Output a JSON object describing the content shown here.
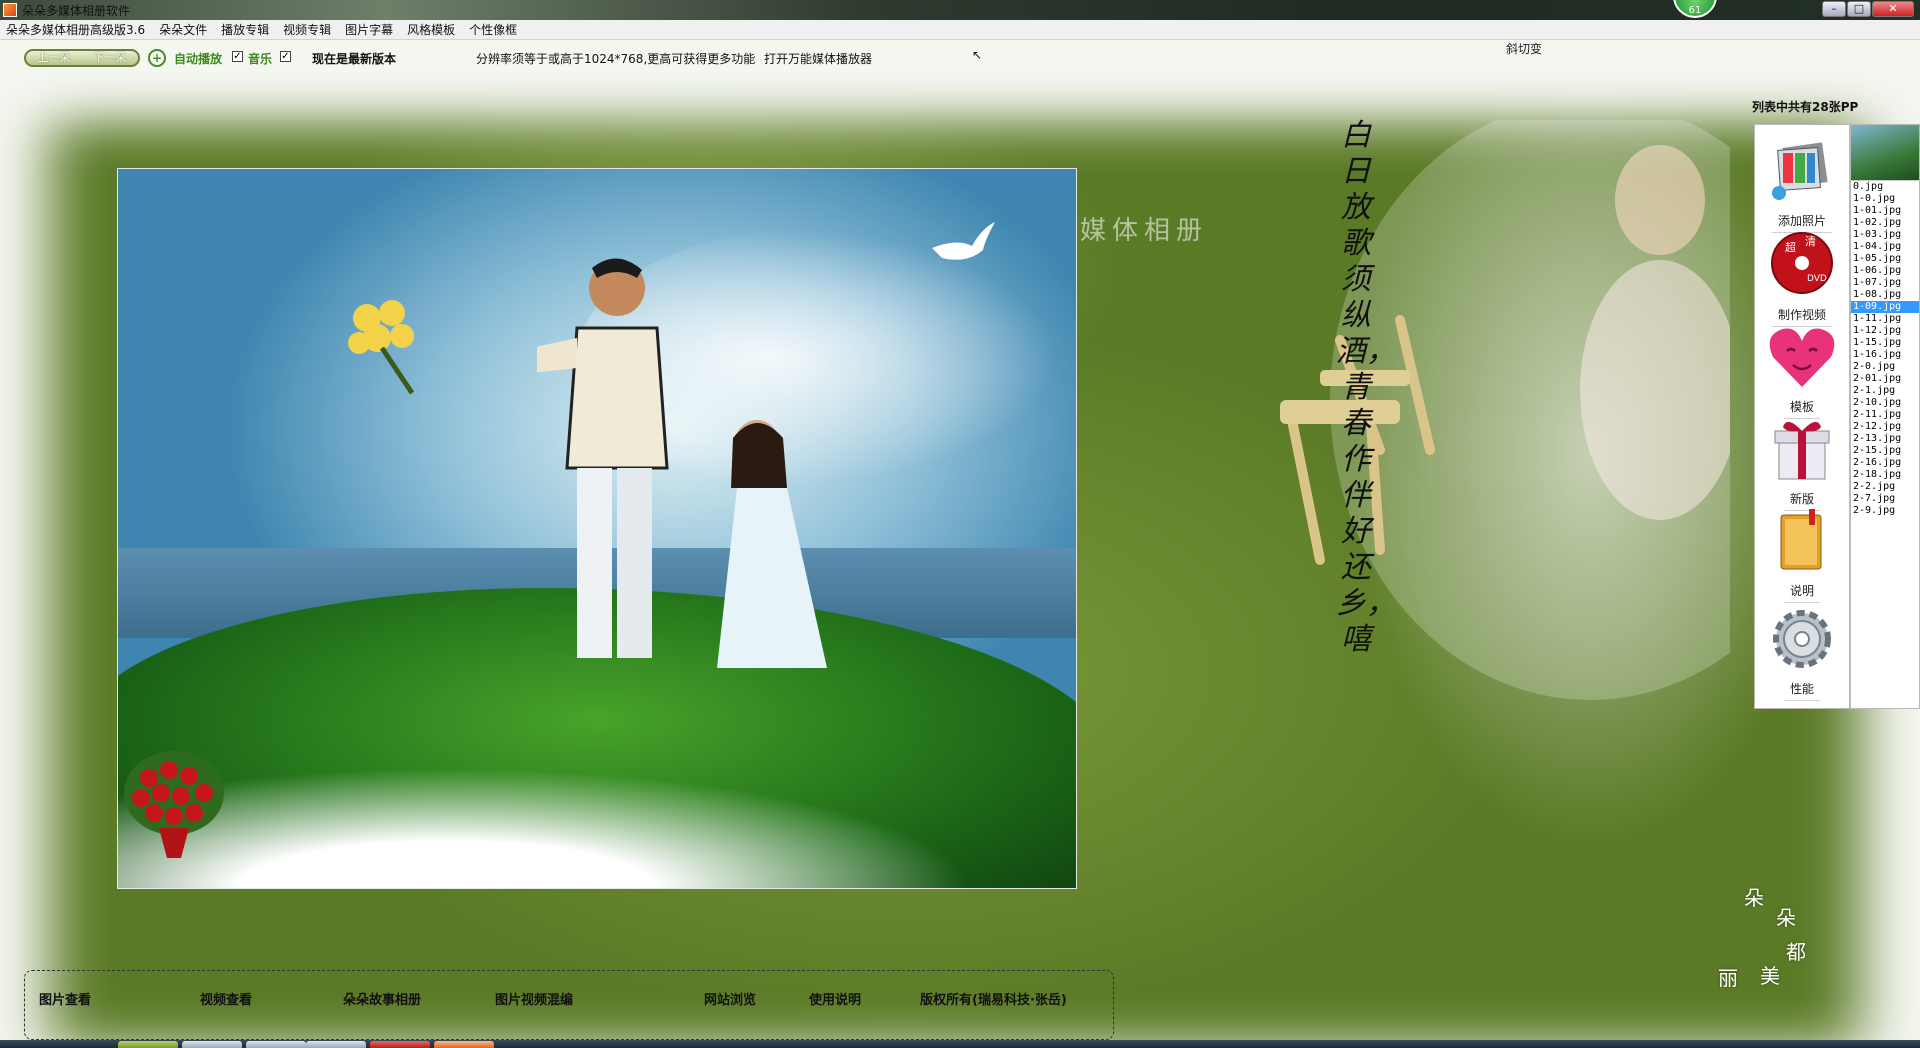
{
  "window": {
    "title": "朵朵多媒体相册软件",
    "badge": "61",
    "buttons": {
      "minimize": "–",
      "maximize": "□",
      "close": "✕"
    }
  },
  "menu": [
    "朵朵多媒体相册高级版3.6",
    "朵朵文件",
    "播放专辑",
    "视频专辑",
    "图片字幕",
    "风格模板",
    "个性像框"
  ],
  "controls": {
    "prev": "上一朵",
    "next": "下一朵",
    "autoplay_label": "自动播放",
    "autoplay_checked": "✓",
    "music_label": "音乐",
    "music_checked": "✓",
    "version_status": "现在是最新版本",
    "resolution_hint": "分辨率须等于或高于1024*768,更高可获得更多功能",
    "open_player": "打开万能媒体播放器",
    "transition": "斜切变"
  },
  "stage": {
    "watermark": "媒体相册",
    "poem": "白日放歌须纵酒，青春作伴好还乡，嘻",
    "signature": [
      "朵",
      "朵",
      "都",
      "丽",
      "美"
    ]
  },
  "side_panel": {
    "list_count": "列表中共有28张PP",
    "buttons": [
      {
        "label": "添加照片",
        "icon": "add-photo-icon"
      },
      {
        "label": "制作视频",
        "icon": "dvd-icon"
      },
      {
        "label": "模板",
        "icon": "heart-icon"
      },
      {
        "label": "新版",
        "icon": "gift-icon"
      },
      {
        "label": "说明",
        "icon": "book-icon"
      },
      {
        "label": "性能",
        "icon": "gear-icon"
      }
    ],
    "files": [
      "0.jpg",
      "1-0.jpg",
      "1-01.jpg",
      "1-02.jpg",
      "1-03.jpg",
      "1-04.jpg",
      "1-05.jpg",
      "1-06.jpg",
      "1-07.jpg",
      "1-08.jpg",
      "1-09.jpg",
      "1-11.jpg",
      "1-12.jpg",
      "1-15.jpg",
      "1-16.jpg",
      "2-0.jpg",
      "2-01.jpg",
      "2-1.jpg",
      "2-10.jpg",
      "2-11.jpg",
      "2-12.jpg",
      "2-13.jpg",
      "2-15.jpg",
      "2-16.jpg",
      "2-18.jpg",
      "2-2.jpg",
      "2-7.jpg",
      "2-9.jpg"
    ],
    "selected_file": "1-09.jpg"
  },
  "bottom_nav": [
    "图片查看",
    "视频查看",
    "朵朵故事相册",
    "图片视频混编",
    "网站浏览",
    "使用说明",
    "版权所有(瑞易科技·张岳)"
  ],
  "colors": {
    "accent_green": "#3c8a1e",
    "selection_blue": "#3399ff",
    "stage_green": "#6b8a30"
  }
}
